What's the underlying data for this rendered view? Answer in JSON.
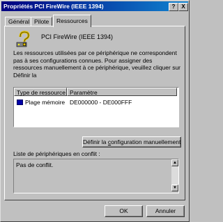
{
  "window": {
    "title": "Propriétés PCI FireWire (IEEE 1394)",
    "help_button": "?",
    "close_button": "X"
  },
  "tabs": [
    {
      "label": "Général"
    },
    {
      "label": "Pilote"
    },
    {
      "label": "Ressources"
    }
  ],
  "device": {
    "name": "PCI FireWire (IEEE 1394)",
    "icon": "unknown-device-question-icon"
  },
  "description": "Les ressources utilisées par ce périphérique ne correspondent pas à ses configurations connues. Pour assigner des ressources manuellement à ce périphérique, veuillez cliquer sur Définir la",
  "resources": {
    "headers": [
      "Type de ressource",
      "Paramètre"
    ],
    "rows": [
      {
        "type": "Plage mémoire",
        "value": "DE000000 - DE000FFF",
        "icon": "memory-range-icon"
      }
    ]
  },
  "define_button": {
    "before": "Définir la ",
    "accel": "c",
    "after": "onfiguration manuellement"
  },
  "conflicts": {
    "label": "Liste de périphériques en conflit :",
    "text": "Pas de conflit."
  },
  "footer": {
    "ok": "OK",
    "cancel": "Annuler"
  }
}
